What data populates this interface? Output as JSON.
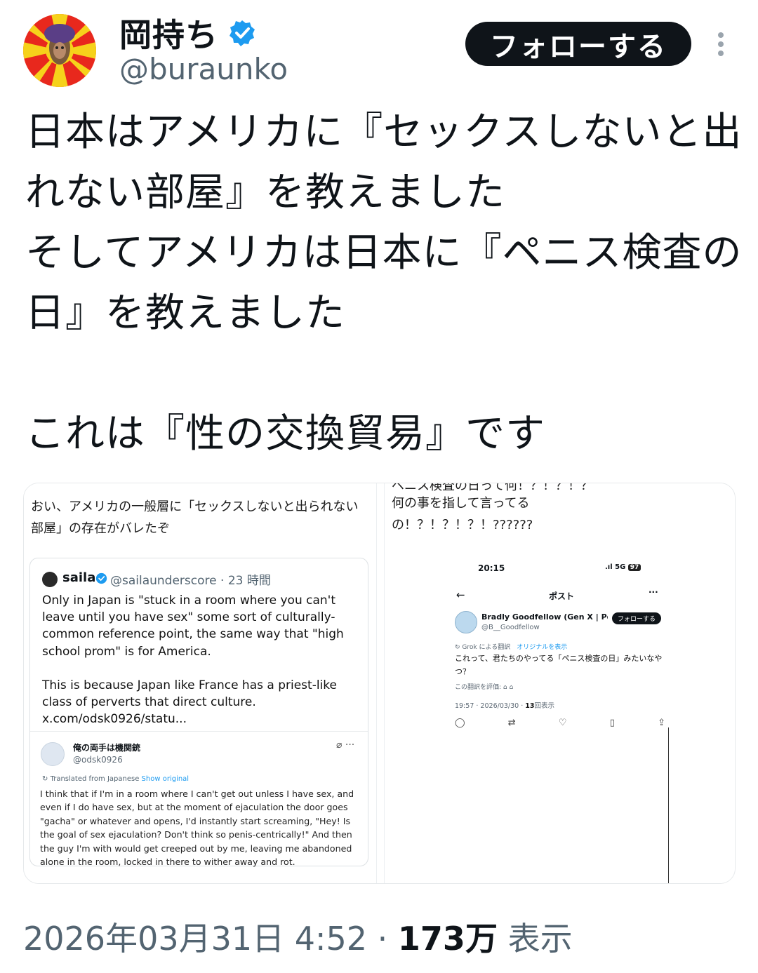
{
  "author": {
    "display_name": "岡持ち",
    "handle": "@buraunko",
    "verified": true,
    "avatar_icon": "profile-photo"
  },
  "actions": {
    "follow_label": "フォローする",
    "more_icon": "more-vertical-icon"
  },
  "tweet": {
    "lines": [
      "日本はアメリカに『セックスしないと出",
      "れない部屋』を教えました",
      "そしてアメリカは日本に『ペニス検査の",
      "日』を教えました",
      "",
      "これは『性の交換貿易』です"
    ]
  },
  "media": {
    "left": {
      "heading": "おい、アメリカの一般層に「セックスしないと出られない部屋」の存在がバレたぞ",
      "quote": {
        "name": "saila",
        "handle_time": "@sailaunderscore · 23 時間",
        "body_p1": "Only in Japan is \"stuck in a room where you can't leave until you have sex\" some sort of culturally-common reference point, the same way that \"high school prom\" is for America.",
        "body_p2": "This is because Japan like France has a priest-like class of perverts that direct culture. x.com/odsk0926/statu...",
        "inner": {
          "name": "俺の両手は機関銃",
          "handle": "@odsk0926",
          "translated_label": "Translated from Japanese",
          "show_original": "Show original",
          "body": "I think that if I'm in a room where I can't get out unless I have sex, and even if I do have sex, but at the moment of ejaculation the door goes \"gacha\" or whatever and opens, I'd instantly start screaming, \"Hey! Is the goal of sex ejaculation? Don't think so penis-centrically!\" And then the guy I'm with would get creeped out by me, leaving me abandoned alone in the room, locked in there to wither away and rot."
        }
      }
    },
    "right": {
      "cut_top": "ペニス検査の日って何！？！？！？",
      "heading_l1": "何の事を指して言ってる",
      "heading_l2": "の！？！？！？！??????",
      "phone": {
        "time": "20:15",
        "signal": "5G",
        "battery": "97",
        "title": "ポスト",
        "name": "Bradly Goodfellow (Gen X | Po...",
        "handle": "@B__Goodfellow",
        "follow_label": "フォローする",
        "translation_label": "Grok による翻訳",
        "show_original": "オリジナルを表示",
        "body": "これって、君たちのやってる「ペニス検査の日」みたいなやつ？",
        "rate_label": "この翻訳を評価:",
        "meta_prefix": "19:57 · 2026/03/30 · ",
        "views": "13",
        "views_label": "回表示"
      }
    }
  },
  "footer": {
    "timestamp": "2026年03月31日 4:52 · ",
    "views": "173万",
    "views_label": " 表示"
  }
}
